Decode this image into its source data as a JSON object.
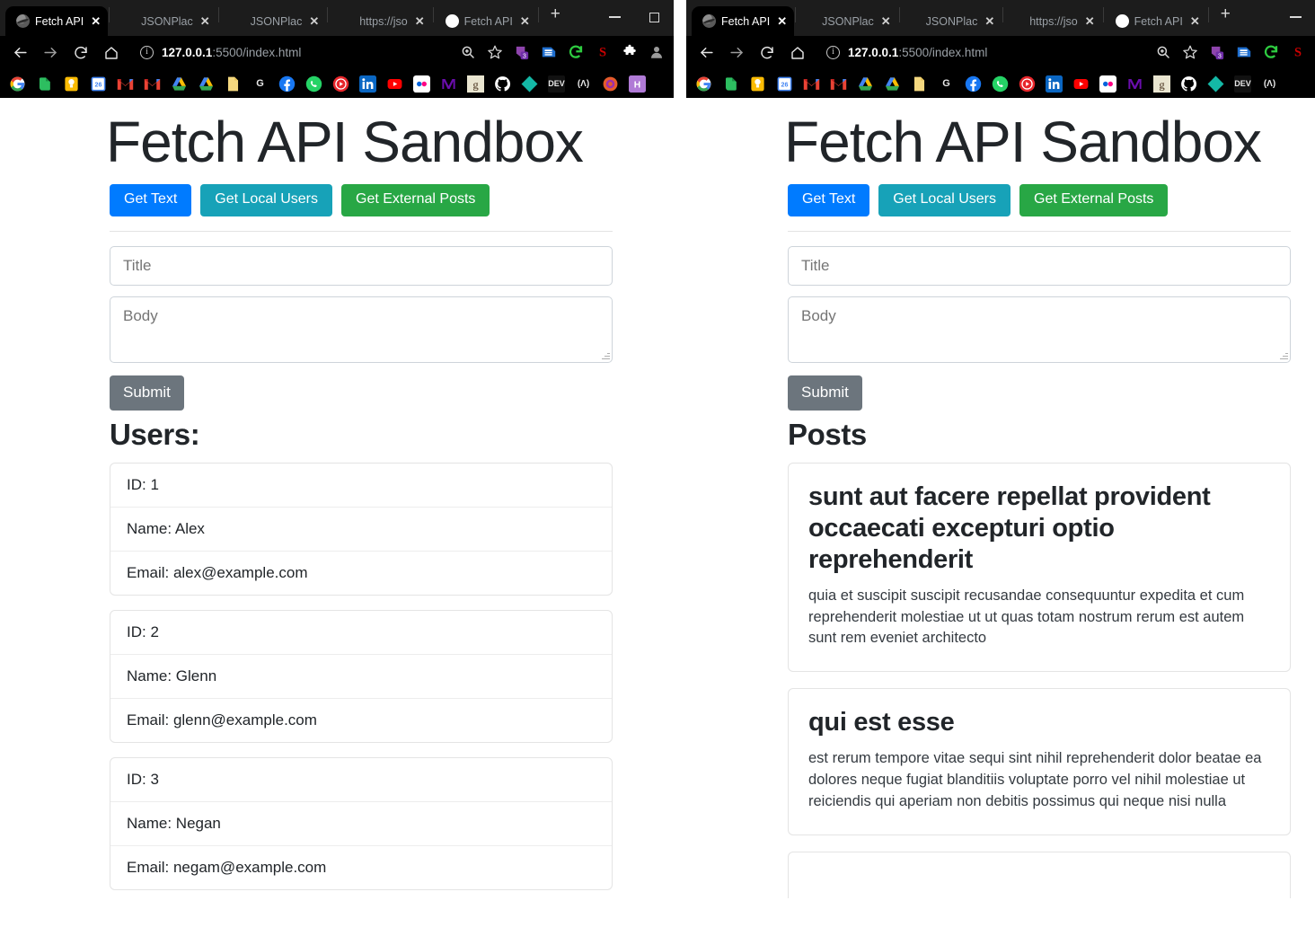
{
  "windows": {
    "left": {
      "tabs": [
        {
          "label": "Fetch API",
          "favicon": "globe-icon",
          "active": true
        },
        {
          "label": "JSONPlac",
          "favicon": "blank-icon",
          "active": false
        },
        {
          "label": "JSONPlac",
          "favicon": "blank-icon",
          "active": false
        },
        {
          "label": "https://jso",
          "favicon": "blank-icon",
          "active": false
        },
        {
          "label": "Fetch API",
          "favicon": "drop-icon",
          "active": false
        }
      ],
      "new_tab_label": "+",
      "close_label": "✕",
      "window_controls": {
        "minimize": "minimize-icon",
        "maximize": "maximize-icon"
      },
      "toolbar": {
        "back": "back-arrow-icon",
        "forward": "forward-arrow-icon",
        "reload": "reload-icon",
        "home": "home-icon",
        "site_info": "info-icon",
        "url_host": "127.0.0.1",
        "url_path": ":5500/index.html",
        "extensions": [
          "zoom-search-icon",
          "bookmark-star-icon",
          "pocket-icon",
          "evernote-clipper-icon",
          "refresh-extension-icon",
          "s-extension-icon",
          "puzzle-extensions-icon",
          "profile-icon"
        ],
        "extension_badge": "3"
      },
      "bookmark_icons": [
        "google-icon",
        "evernote-icon",
        "keep-icon",
        "calendar-icon",
        "gmail-icon",
        "gmail-alt-icon",
        "drive-icon",
        "drive-alt-icon",
        "docs-icon",
        "g-icon",
        "facebook-icon",
        "whatsapp-icon",
        "player-icon",
        "linkedin-icon",
        "youtube-icon",
        "flickr-icon",
        "medium-icon",
        "goodreads-icon",
        "github-icon",
        "diamond-icon",
        "dev-icon",
        "a-icon",
        "firefox-icon",
        "h-icon"
      ]
    },
    "right": {
      "tabs": [
        {
          "label": "Fetch API",
          "favicon": "globe-icon",
          "active": true
        },
        {
          "label": "JSONPlac",
          "favicon": "blank-icon",
          "active": false
        },
        {
          "label": "JSONPlac",
          "favicon": "blank-icon",
          "active": false
        },
        {
          "label": "https://jso",
          "favicon": "blank-icon",
          "active": false
        },
        {
          "label": "Fetch API",
          "favicon": "drop-icon",
          "active": false
        }
      ],
      "new_tab_label": "+",
      "close_label": "✕",
      "window_controls": {
        "minimize": "minimize-icon"
      },
      "toolbar": {
        "back": "back-arrow-icon",
        "forward": "forward-arrow-icon",
        "reload": "reload-icon",
        "home": "home-icon",
        "site_info": "info-icon",
        "url_host": "127.0.0.1",
        "url_path": ":5500/index.html",
        "extensions": [
          "zoom-search-icon",
          "bookmark-star-icon",
          "pocket-icon",
          "evernote-clipper-icon",
          "refresh-extension-icon",
          "s-extension-icon"
        ],
        "extension_badge": "3"
      },
      "bookmark_icons": [
        "google-icon",
        "evernote-icon",
        "keep-icon",
        "calendar-icon",
        "gmail-icon",
        "gmail-alt-icon",
        "drive-icon",
        "drive-alt-icon",
        "docs-icon",
        "g-icon",
        "facebook-icon",
        "whatsapp-icon",
        "player-icon",
        "linkedin-icon",
        "youtube-icon",
        "flickr-icon",
        "medium-icon",
        "goodreads-icon",
        "github-icon",
        "diamond-icon",
        "dev-icon",
        "a-icon"
      ]
    }
  },
  "app": {
    "title": "Fetch API Sandbox",
    "buttons": [
      {
        "label": "Get Text",
        "color": "#007bff"
      },
      {
        "label": "Get Local Users",
        "color": "#17a2b8"
      },
      {
        "label": "Get External Posts",
        "color": "#28a745"
      }
    ],
    "form": {
      "title_placeholder": "Title",
      "title_value": "",
      "body_placeholder": "Body",
      "body_value": "",
      "submit_label": "Submit",
      "submit_color": "#6c757d"
    }
  },
  "left_output": {
    "heading": "Users:",
    "users": [
      {
        "id": "ID: 1",
        "name": "Name: Alex",
        "email": "Email: alex@example.com"
      },
      {
        "id": "ID: 2",
        "name": "Name: Glenn",
        "email": "Email: glenn@example.com"
      },
      {
        "id": "ID: 3",
        "name": "Name: Negan",
        "email": "Email: negam@example.com"
      }
    ]
  },
  "right_output": {
    "heading": "Posts",
    "posts": [
      {
        "title": "sunt aut facere repellat provident occaecati excepturi optio reprehenderit",
        "body": "quia et suscipit suscipit recusandae consequuntur expedita et cum reprehenderit molestiae ut ut quas totam nostrum rerum est autem sunt rem eveniet architecto"
      },
      {
        "title": "qui est esse",
        "body": "est rerum tempore vitae sequi sint nihil reprehenderit dolor beatae ea dolores neque fugiat blanditiis voluptate porro vel nihil molestiae ut reiciendis qui aperiam non debitis possimus qui neque nisi nulla"
      }
    ]
  }
}
